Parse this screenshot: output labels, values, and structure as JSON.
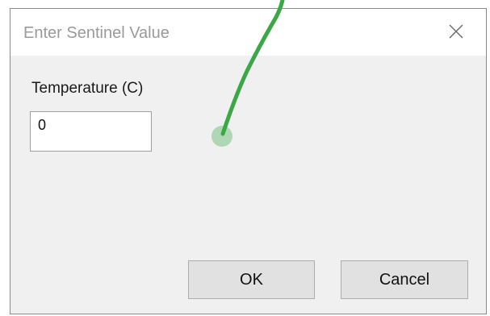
{
  "dialog": {
    "title": "Enter Sentinel Value",
    "close_icon": "close-icon"
  },
  "field": {
    "label": "Temperature (C)",
    "value": "0"
  },
  "buttons": {
    "ok_label": "OK",
    "cancel_label": "Cancel"
  },
  "annotation": {
    "color": "#3aa845"
  }
}
